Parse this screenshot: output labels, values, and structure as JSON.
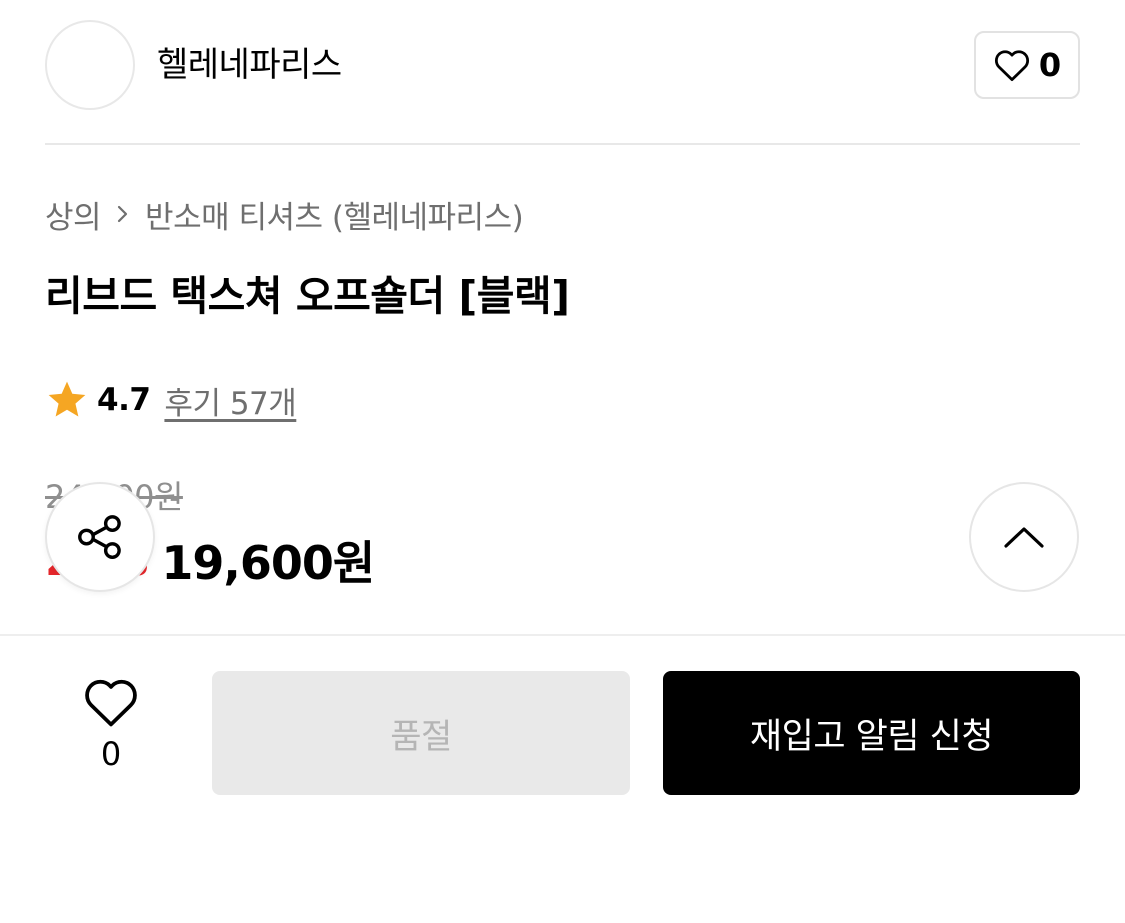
{
  "brand": {
    "name": "헬레네파리스",
    "like_count": "0"
  },
  "breadcrumb": {
    "category": "상의",
    "separator": ">",
    "subcategory": "반소매 티셔츠 (헬레네파리스)"
  },
  "product": {
    "title": "리브드 택스쳐 오프숄더 [블랙]",
    "rating": "4.7",
    "reviews_label": "후기 57개",
    "original_price": "24,500원",
    "discount": "20%",
    "sale_price": "19,600원"
  },
  "bottom_bar": {
    "like_count": "0",
    "soldout_label": "품절",
    "restock_label": "재입고 알림 신청"
  },
  "colors": {
    "accent_red": "#e4262b",
    "star": "#f5a623",
    "primary_button": "#000000",
    "disabled_button": "#e9e9e9"
  },
  "icons": {
    "brand_like": "heart-outline-icon",
    "rating": "star-icon",
    "share": "share-icon",
    "scroll_top": "chevron-up-icon",
    "bottom_like": "heart-outline-icon"
  }
}
